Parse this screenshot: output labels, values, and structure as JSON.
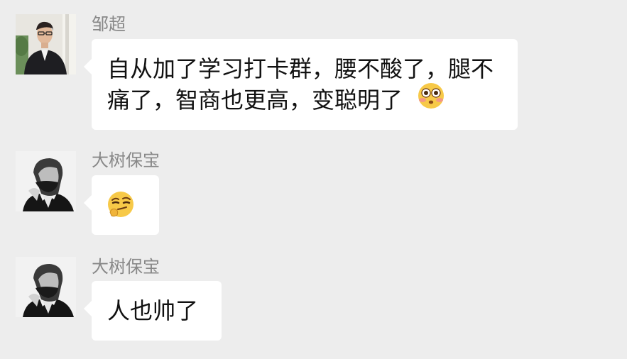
{
  "conversation": {
    "messages": [
      {
        "sender": "邹超",
        "avatar": "portrait-man-glasses",
        "text": "自从加了学习打卡群，腰不酸了，腿不痛了，智商也更高，变聪明了",
        "trailing_emoji": "flushed-face-emoji"
      },
      {
        "sender": "大树保宝",
        "avatar": "portrait-mustached-man-bw",
        "emoji_only": "thinking-smirk-emoji"
      },
      {
        "sender": "大树保宝",
        "avatar": "portrait-mustached-man-bw",
        "text": "人也帅了"
      }
    ]
  },
  "colors": {
    "background": "#ededed",
    "bubble": "#ffffff",
    "sender_name": "#888888",
    "text": "#111111"
  }
}
